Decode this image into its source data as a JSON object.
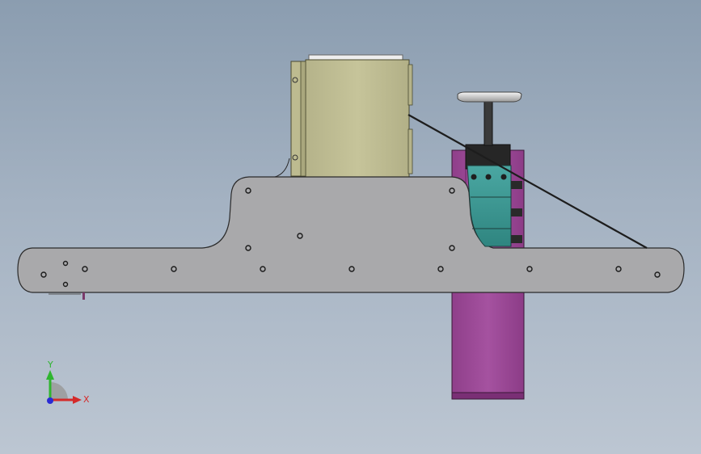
{
  "window": {
    "title": "",
    "view": "front"
  },
  "colors": {
    "background_top": "#8b9db0",
    "background_bottom": "#bcc6d2",
    "plate": "#a7a7a9",
    "cabinet": "#c3c196",
    "purple": "#a24f9c",
    "teal": "#3f9c97",
    "dark": "#262626"
  },
  "triad": {
    "x_label": "X",
    "y_label": "Y",
    "x_color": "#d42a2a",
    "y_color": "#2fb52f",
    "z_color": "#2a2ad4"
  },
  "parts": [
    {
      "name": "base-plate",
      "icon": "plate-icon"
    },
    {
      "name": "control-cabinet",
      "icon": "box-icon"
    },
    {
      "name": "vertical-column",
      "icon": "column-icon"
    },
    {
      "name": "mounting-bracket",
      "icon": "bracket-icon"
    },
    {
      "name": "support-cable",
      "icon": "cable-icon"
    }
  ]
}
